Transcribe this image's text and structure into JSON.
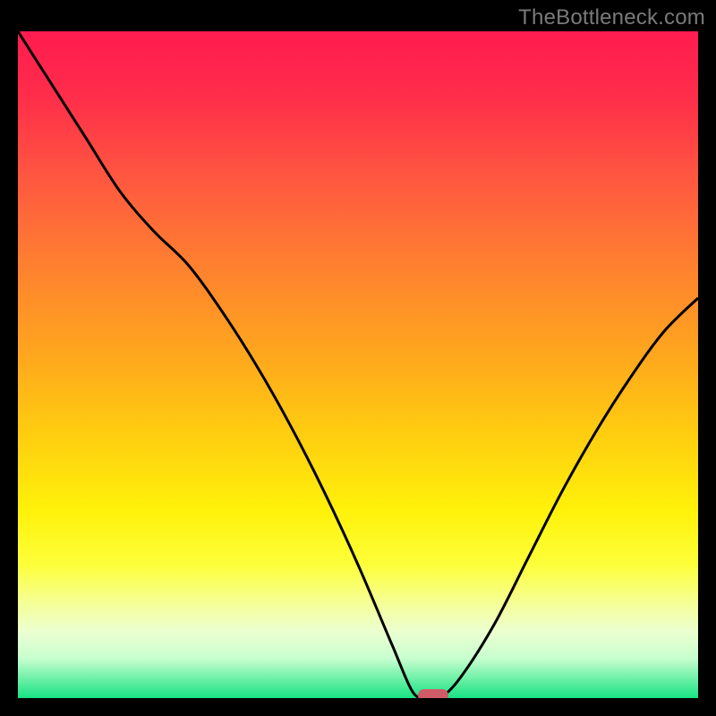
{
  "watermark": "TheBottleneck.com",
  "colors": {
    "black": "#000000",
    "curve": "#000000",
    "marker": "#cf5b66",
    "gradient_stops": [
      {
        "offset": 0.0,
        "color": "#ff1b4f"
      },
      {
        "offset": 0.1,
        "color": "#ff2e4a"
      },
      {
        "offset": 0.22,
        "color": "#ff5740"
      },
      {
        "offset": 0.35,
        "color": "#ff8030"
      },
      {
        "offset": 0.48,
        "color": "#ffa51e"
      },
      {
        "offset": 0.6,
        "color": "#ffcc10"
      },
      {
        "offset": 0.72,
        "color": "#fff20a"
      },
      {
        "offset": 0.8,
        "color": "#fdff3a"
      },
      {
        "offset": 0.86,
        "color": "#f5ff9a"
      },
      {
        "offset": 0.9,
        "color": "#ecffd0"
      },
      {
        "offset": 0.94,
        "color": "#c8ffcf"
      },
      {
        "offset": 0.97,
        "color": "#70f0a8"
      },
      {
        "offset": 1.0,
        "color": "#17e384"
      }
    ]
  },
  "chart_data": {
    "type": "line",
    "title": "",
    "xlabel": "",
    "ylabel": "",
    "xlim": [
      0,
      100
    ],
    "ylim": [
      0,
      100
    ],
    "x": [
      0,
      5,
      10,
      15,
      20,
      25,
      30,
      35,
      40,
      45,
      50,
      55,
      58,
      60,
      62,
      65,
      70,
      75,
      80,
      85,
      90,
      95,
      100
    ],
    "values": [
      100,
      92,
      84,
      76,
      70,
      65,
      58,
      50,
      41,
      31,
      20,
      8,
      1,
      0,
      0,
      3,
      11,
      21,
      31,
      40,
      48,
      55,
      60
    ],
    "marker_x": 61,
    "marker_y": 0,
    "annotations": []
  }
}
